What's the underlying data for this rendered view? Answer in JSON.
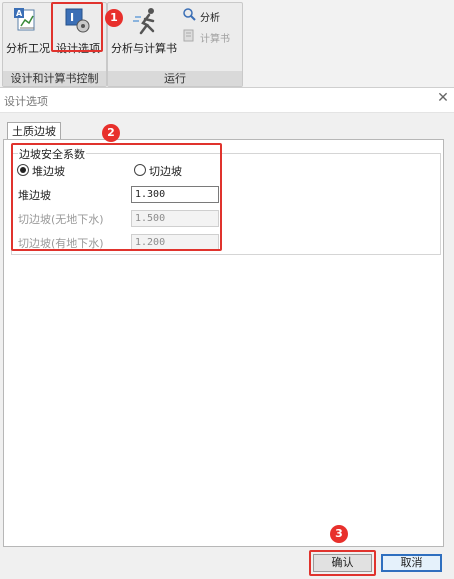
{
  "ribbon": {
    "group1": {
      "caption": "设计和计算书控制",
      "analysis_case_label": "分析工况",
      "design_options_label": "设计选项"
    },
    "group2": {
      "caption": "运行",
      "analyze_and_calc_label": "分析与计算书",
      "analyze_label": "分析",
      "calc_book_label": "计算书"
    }
  },
  "dialog": {
    "title": "设计选项",
    "close_glyph": "✕",
    "tab_label": "土质边坡",
    "group_title": "边坡安全系数",
    "radio_fill_label": "堆边坡",
    "radio_cut_label": "切边坡",
    "fields": [
      {
        "label": "堆边坡",
        "value": "1.300"
      },
      {
        "label": "切边坡(无地下水)",
        "value": "1.500"
      },
      {
        "label": "切边坡(有地下水)",
        "value": "1.200"
      }
    ],
    "ok_label": "确认",
    "cancel_label": "取消"
  },
  "annotations": [
    "1",
    "2",
    "3"
  ],
  "colors": {
    "highlight": "#e0332d",
    "badge": "#e8302c",
    "focus": "#2f6fbf"
  },
  "icons": [
    "analysis-case-icon",
    "design-options-icon",
    "runner-icon",
    "analyze-icon",
    "calc-book-icon"
  ]
}
